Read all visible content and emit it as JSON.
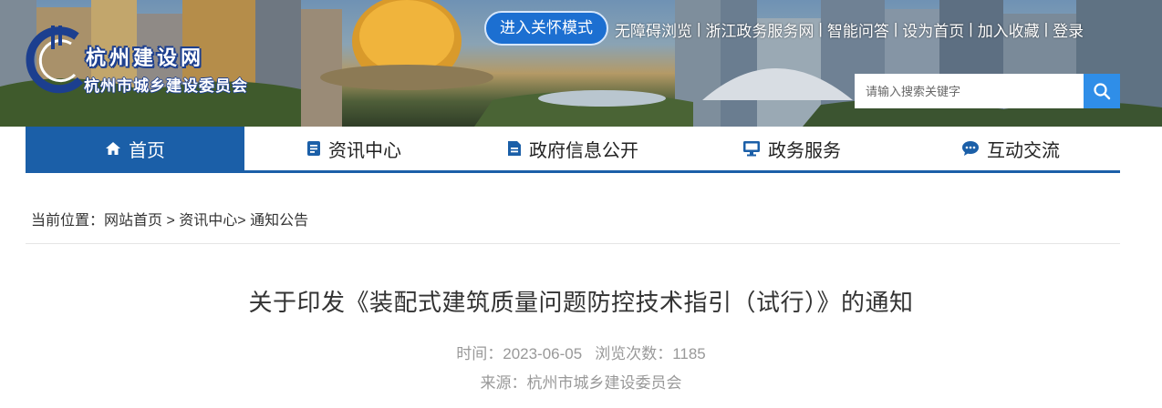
{
  "header": {
    "logo_title": "杭州建设网",
    "logo_subtitle": "杭州市城乡建设委员会",
    "care_mode_button": "进入关怀模式",
    "top_links": [
      "无障碍浏览",
      "浙江政务服务网",
      "智能问答",
      "设为首页",
      "加入收藏",
      "登录"
    ],
    "link_separator": "|",
    "search_placeholder": "请输入搜索关键字",
    "search_icon": "search-icon"
  },
  "nav": {
    "items": [
      {
        "label": "首页",
        "icon": "home-icon",
        "active": true
      },
      {
        "label": "资讯中心",
        "icon": "document-icon",
        "active": false
      },
      {
        "label": "政府信息公开",
        "icon": "file-icon",
        "active": false
      },
      {
        "label": "政务服务",
        "icon": "monitor-icon",
        "active": false
      },
      {
        "label": "互动交流",
        "icon": "chat-icon",
        "active": false
      }
    ]
  },
  "breadcrumb": {
    "prefix": "当前位置：",
    "items": [
      "网站首页",
      "资讯中心",
      "通知公告"
    ],
    "sep1": " > ",
    "sep2": "> "
  },
  "article": {
    "title": "关于印发《装配式建筑质量问题防控技术指引（试行）》的通知",
    "date_label": "时间：",
    "date": "2023-06-05",
    "views_label": "浏览次数：",
    "views": "1185",
    "source_label": "来源：",
    "source": "杭州市城乡建设委员会"
  },
  "colors": {
    "nav_active": "#1b5fa8",
    "care_button": "#1c6fd1",
    "search_button": "#2f8ee8",
    "meta_text": "#999999"
  }
}
